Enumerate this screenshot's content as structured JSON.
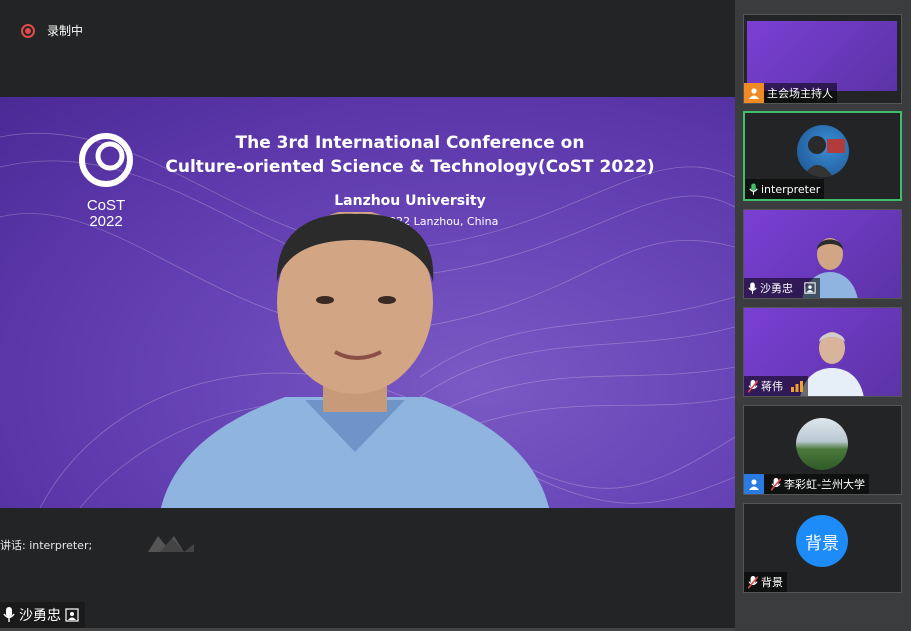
{
  "recording": {
    "label": "录制中"
  },
  "banner": {
    "title_line1": "The 3rd International Conference on",
    "title_line2": "Culture-oriented Science & Technology(CoST 2022)",
    "venue": "Lanzhou University",
    "dates": "18-21 Au     , 2022  Lanzhou, China",
    "logo_text_top": "CoST",
    "logo_text_bottom": "2022"
  },
  "speaking": {
    "text": "讲话: interpreter;"
  },
  "active_speaker": {
    "name": "沙勇忠"
  },
  "participants": [
    {
      "name": "主会场主持人",
      "icon": "user-icon",
      "icon_color": "#f08a24"
    },
    {
      "name": "interpreter",
      "icon": "mic-active-icon",
      "icon_color": "#3fbf6a"
    },
    {
      "name": "沙勇忠",
      "icon": "mic-icon"
    },
    {
      "name": "蒋伟",
      "icon": "mic-muted-icon"
    },
    {
      "name": "李彩虹-兰州大学",
      "icon": "mic-muted-icon"
    },
    {
      "name": "背景",
      "icon": "mic-muted-icon",
      "avatar_text": "背景",
      "avatar_color": "#1d8cf8"
    }
  ],
  "colors": {
    "accent_active": "#3fbf6a",
    "recording": "#e24b4b",
    "slide_purple": "#6a47b8"
  }
}
